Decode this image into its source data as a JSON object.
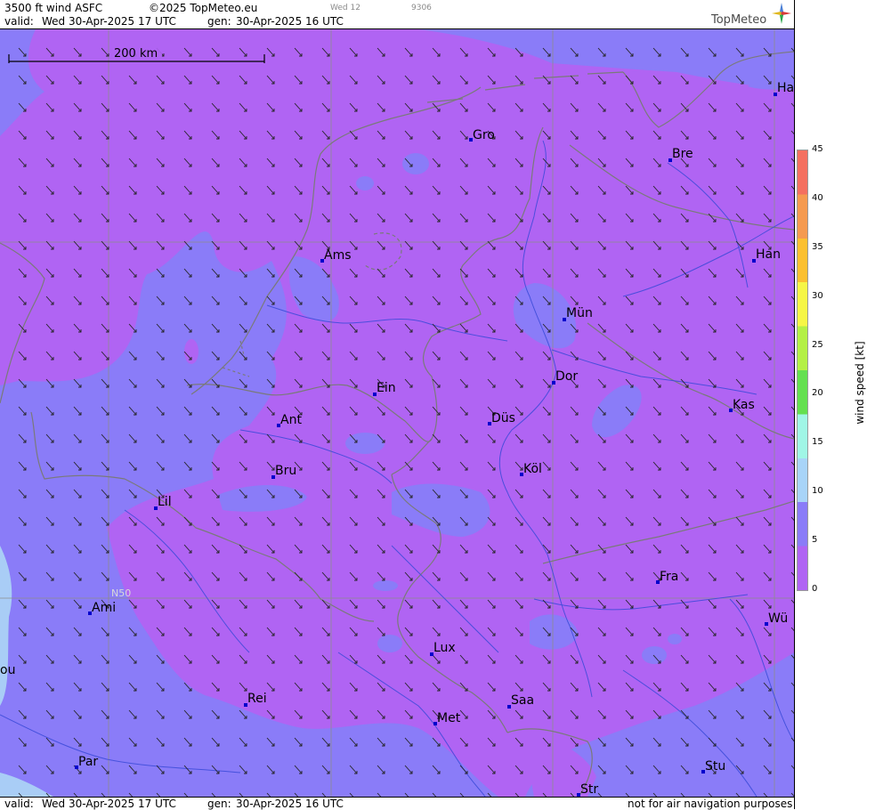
{
  "header": {
    "product": "3500 ft wind ASFC",
    "copyright": "©2025 TopMeteo.eu",
    "valid_label": "valid:",
    "valid_value": "Wed  30-Apr-2025  17 UTC",
    "gen_label": "gen:",
    "gen_value": "30-Apr-2025 16 UTC",
    "faint_day": "Wed 12",
    "faint_code": "9306",
    "brand": "TopMeteo"
  },
  "footer": {
    "valid_label": "valid:",
    "valid_value": "Wed  30-Apr-2025  17 UTC",
    "gen_label": "gen:",
    "gen_value": "30-Apr-2025 16 UTC",
    "disclaimer": "not for air navigation purposes"
  },
  "map": {
    "scale_label": "200 km",
    "lat_label": "N50",
    "colors": {
      "calm": "#b064f3",
      "light": "#8a7cf8",
      "moderate": "#a9cdf6",
      "border": "#7a7a7a",
      "river": "#3a4ad8",
      "grid": "#8c8c8c",
      "city": "#0000cc"
    },
    "cities": [
      {
        "name": "Gro"
      },
      {
        "name": "Bre"
      },
      {
        "name": "Ha"
      },
      {
        "name": "Ams"
      },
      {
        "name": "Han"
      },
      {
        "name": "Mün"
      },
      {
        "name": "Ein"
      },
      {
        "name": "Dor"
      },
      {
        "name": "Ant"
      },
      {
        "name": "Düs"
      },
      {
        "name": "Kas"
      },
      {
        "name": "Bru"
      },
      {
        "name": "Köl"
      },
      {
        "name": "Lil"
      },
      {
        "name": "Fra"
      },
      {
        "name": "Ami"
      },
      {
        "name": "Wü"
      },
      {
        "name": "ou"
      },
      {
        "name": "Lux"
      },
      {
        "name": "Rei"
      },
      {
        "name": "Saa"
      },
      {
        "name": "Met"
      },
      {
        "name": "Par"
      },
      {
        "name": "Stu"
      },
      {
        "name": "Str"
      }
    ]
  },
  "colorbar": {
    "title": "wind speed  [kt]",
    "ticks": [
      "45",
      "40",
      "35",
      "30",
      "25",
      "20",
      "15",
      "10",
      "5",
      "0"
    ],
    "colors": [
      "#f47060",
      "#f59a50",
      "#fcc030",
      "#f6f646",
      "#b4f046",
      "#64e050",
      "#a0f6e6",
      "#a8d4f8",
      "#8a7cf8",
      "#b064f3"
    ]
  }
}
